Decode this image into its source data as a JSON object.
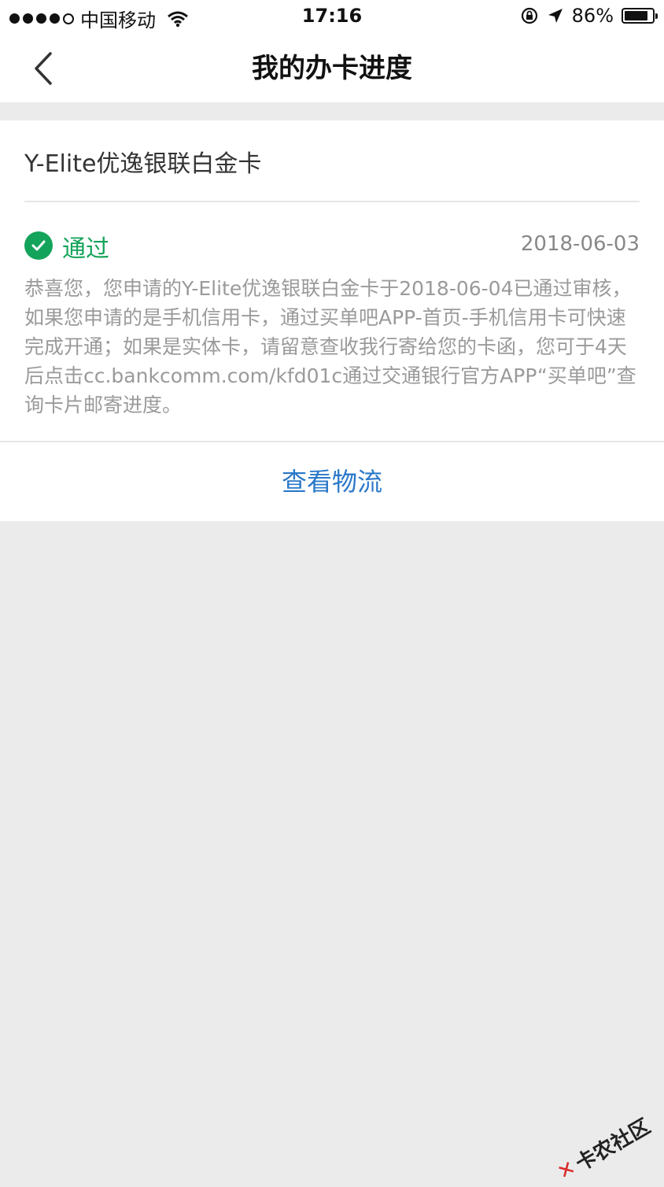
{
  "status_bar": {
    "carrier": "中国移动",
    "time": "17:16",
    "battery": "86%",
    "battery_level": 0.86
  },
  "nav": {
    "title": "我的办卡进度"
  },
  "card": {
    "name": "Y-Elite优逸银联白金卡",
    "status": "通过",
    "date": "2018-06-03",
    "message": "恭喜您，您申请的Y-Elite优逸银联白金卡于2018-06-04已通过审核，如果您申请的是手机信用卡，通过买单吧APP-首页-手机信用卡可快速完成开通；如果是实体卡，请留意查收我行寄给您的卡函，您可于4天后点击cc.bankcomm.com/kfd01c通过交通银行官方APP“买单吧”查询卡片邮寄进度。"
  },
  "actions": {
    "logistics_label": "查看物流"
  },
  "watermark": {
    "text": "卡农社区"
  },
  "colors": {
    "accent_green": "#14a35a",
    "link_blue": "#2a78c8"
  }
}
